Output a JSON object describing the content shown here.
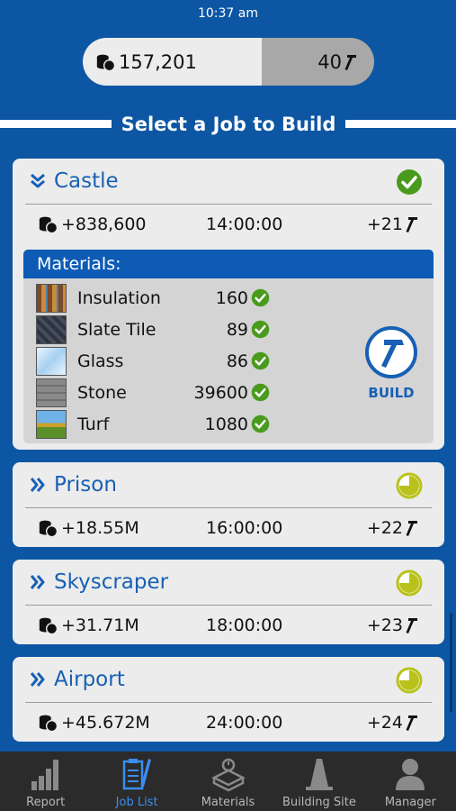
{
  "status_bar": {
    "time": "10:37 am"
  },
  "balance": {
    "coins": "157,201",
    "hammers": "40"
  },
  "page_title": "Select a Job to Build",
  "colors": {
    "brand_blue": "#0c56a3",
    "accent_blue": "#1760b4",
    "check_green": "#4a9a1e",
    "pending_yellow": "#b8c21a"
  },
  "jobs": [
    {
      "name": "Castle",
      "status": "ready",
      "reward": "+838,600",
      "duration": "14:00:00",
      "xp": "+21",
      "expanded": true,
      "materials_label": "Materials:",
      "materials": [
        {
          "name": "Insulation",
          "qty": "160"
        },
        {
          "name": "Slate Tile",
          "qty": "89"
        },
        {
          "name": "Glass",
          "qty": "86"
        },
        {
          "name": "Stone",
          "qty": "39600"
        },
        {
          "name": "Turf",
          "qty": "1080"
        }
      ],
      "build_label": "BUILD"
    },
    {
      "name": "Prison",
      "status": "pending",
      "reward": "+18.55M",
      "duration": "16:00:00",
      "xp": "+22"
    },
    {
      "name": "Skyscraper",
      "status": "pending",
      "reward": "+31.71M",
      "duration": "18:00:00",
      "xp": "+23"
    },
    {
      "name": "Airport",
      "status": "pending",
      "reward": "+45.672M",
      "duration": "24:00:00",
      "xp": "+24"
    }
  ],
  "tabs": [
    {
      "label": "Report",
      "icon": "bar-chart-icon"
    },
    {
      "label": "Job List",
      "icon": "clipboard-pencil-icon",
      "active": true
    },
    {
      "label": "Materials",
      "icon": "materials-icon"
    },
    {
      "label": "Building Site",
      "icon": "traffic-cone-icon"
    },
    {
      "label": "Manager",
      "icon": "person-icon"
    }
  ]
}
